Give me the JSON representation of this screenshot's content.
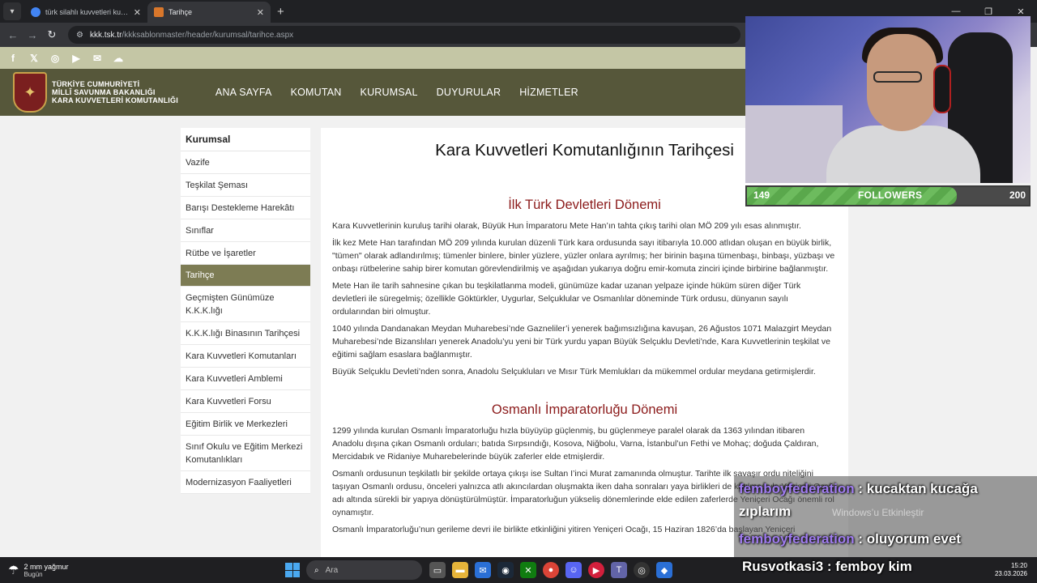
{
  "browser": {
    "tabs": [
      {
        "title": "türk silahlı kuvvetleri kuruluş ta",
        "favicon_color": "#4285f4",
        "active": false
      },
      {
        "title": "Tarihçe",
        "favicon_color": "#d9772b",
        "active": true
      }
    ],
    "url_host": "kkk.tsk.tr",
    "url_path": "/kkksablonmaster/header/kurumsal/tarihce.aspx"
  },
  "site": {
    "social_icons": [
      "facebook-icon",
      "x-icon",
      "instagram-icon",
      "youtube-icon",
      "mail-icon",
      "rss-icon"
    ],
    "brand": {
      "line1": "TÜRKİYE CUMHURİYETİ",
      "line2": "MİLLÎ SAVUNMA BAKANLIĞI",
      "line3": "KARA KUVVETLERİ KOMUTANLIĞI"
    },
    "nav": [
      "ANA SAYFA",
      "KOMUTAN",
      "KURUMSAL",
      "DUYURULAR",
      "HİZMETLER"
    ],
    "sidebar": {
      "title": "Kurumsal",
      "items": [
        {
          "label": "Vazife"
        },
        {
          "label": "Teşkilat Şeması"
        },
        {
          "label": "Barışı Destekleme Harekâtı"
        },
        {
          "label": "Sınıflar"
        },
        {
          "label": "Rütbe ve İşaretler"
        },
        {
          "label": "Tarihçe"
        },
        {
          "label": "Geçmişten Günümüze K.K.K.lığı"
        },
        {
          "label": "K.K.K.lığı Binasının Tarihçesi"
        },
        {
          "label": "Kara Kuvvetleri Komutanları"
        },
        {
          "label": "Kara Kuvvetleri Amblemi"
        },
        {
          "label": "Kara Kuvvetleri Forsu"
        },
        {
          "label": "Eğitim Birlik ve Merkezleri"
        },
        {
          "label": "Sınıf Okulu ve Eğitim Merkezi Komutanlıkları"
        },
        {
          "label": "Modernizasyon Faaliyetleri"
        }
      ]
    },
    "content": {
      "title": "Kara Kuvvetleri Komutanlığının Tarihçesi",
      "section1": {
        "heading": "İlk Türk Devletleri Dönemi",
        "paragraphs": [
          "Kara Kuvvetlerinin kuruluş tarihi olarak, Büyük Hun İmparatoru Mete Han’ın tahta çıkış tarihi olan MÖ 209 yılı esas alınmıştır.",
          "İlk kez Mete Han tarafından MÖ 209 yılında kurulan düzenli Türk kara ordusunda sayı itibarıyla 10.000 atlıdan oluşan en büyük birlik, \"tümen\" olarak adlandırılmış; tümenler binlere, binler yüzlere, yüzler onlara ayrılmış; her birinin başına tümenbaşı, binbaşı, yüzbaşı ve onbaşı rütbelerine sahip birer komutan görevlendirilmiş ve aşağıdan yukarıya doğru emir-komuta zinciri içinde birbirine bağlanmıştır.",
          "Mete Han ile tarih sahnesine çıkan bu teşkilatlanma modeli, günümüze kadar uzanan yelpaze içinde hüküm süren diğer Türk devletleri ile süregelmiş; özellikle Göktürkler, Uygurlar, Selçuklular ve Osmanlılar döneminde Türk ordusu, dünyanın sayılı ordularından biri olmuştur.",
          "1040 yılında Dandanakan Meydan Muharebesi’nde Gazneliler’i yenerek bağımsızlığına kavuşan, 26 Ağustos 1071 Malazgirt Meydan Muharebesi’nde Bizanslıları yenerek Anadolu’yu yeni bir Türk yurdu yapan Büyük Selçuklu Devleti’nde, Kara Kuvvetlerinin teşkilat ve eğitimi sağlam esaslara bağlanmıştır.",
          "Büyük Selçuklu Devleti’nden sonra, Anadolu Selçukluları ve Mısır Türk Memlukları da mükemmel ordular meydana getirmişlerdir."
        ]
      },
      "section2": {
        "heading": "Osmanlı İmparatorluğu Dönemi",
        "paragraphs": [
          "1299 yılında kurulan Osmanlı İmparatorluğu hızla büyüyüp güçlenmiş, bu güçlenmeye paralel olarak da 1363 yılından itibaren Anadolu dışına çıkan Osmanlı orduları; batıda Sırpsındığı, Kosova, Niğbolu, Varna, İstanbul’un Fethi ve Mohaç; doğuda Çaldıran, Mercidabık ve Ridaniye Muharebelerinde büyük zaferler elde etmişlerdir.",
          "Osmanlı ordusunun teşkilatlı bir şekilde ortaya çıkışı ise Sultan I’inci Murat zamanında olmuştur. Tarihte ilk savaşır ordu niteliğini taşıyan Osmanlı ordusu, önceleri yalnızca atlı akıncılardan oluşmakta iken daha sonraları yaya birlikleri de katılmasıyla Yeniçeri Ocağı adı altında sürekli bir yapıya dönüştürülmüştür. İmparatorluğun yükseliş dönemlerinde elde edilen zaferlerde Yeniçeri Ocağı önemli rol oynamıştır.",
          "Osmanlı İmparatorluğu’nun gerileme devri ile birlikte etkinliğini yitiren Yeniçeri Ocağı, 15 Haziran 1826’da başlayan Yeniçeri"
        ]
      }
    }
  },
  "stream": {
    "followers": {
      "current": "149",
      "label": "FOLLOWERS",
      "goal": "200",
      "progress_fraction": 0.745
    },
    "chat": [
      {
        "user": "femboyfederation",
        "message": ": kucaktan kucağa"
      },
      {
        "wrap": "zıplarım"
      },
      {
        "user": "femboyfederation",
        "message": ": oluyorum evet"
      },
      {
        "user": "Rusvotkasi3",
        "message": ": femboy kim"
      }
    ],
    "watermark": "Windows’u Etkinleştir"
  },
  "taskbar": {
    "weather_temp": "2 mm yağmur",
    "weather_day": "Bugün",
    "search_placeholder": "Ara",
    "time": "15:20",
    "date": "23.03.2026"
  }
}
